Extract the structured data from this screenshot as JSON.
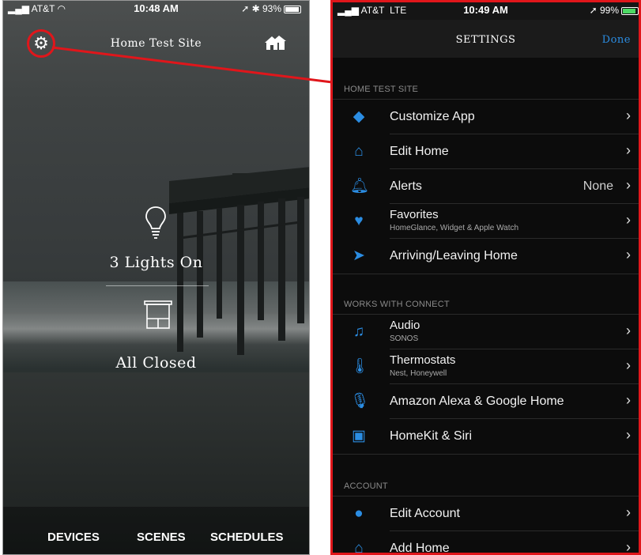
{
  "left": {
    "status": {
      "carrier": "AT&T",
      "time": "10:48 AM",
      "battery": "93%"
    },
    "title": "Home Test Site",
    "lights": "3 Lights On",
    "shades": "All Closed",
    "nav": {
      "devices": "DEVICES",
      "scenes": "SCENES",
      "schedules": "SCHEDULES"
    }
  },
  "right": {
    "status": {
      "carrier": "AT&T",
      "network": "LTE",
      "time": "10:49 AM",
      "battery": "99%"
    },
    "title": "Settings",
    "done": "Done",
    "sections": [
      {
        "header": "HOME TEST SITE"
      },
      {
        "header": "WORKS WITH CONNECT"
      },
      {
        "header": "ACCOUNT"
      }
    ],
    "rows": [
      {
        "label": "Customize App",
        "icon": "cards-icon"
      },
      {
        "label": "Edit Home",
        "icon": "house-icon"
      },
      {
        "label": "Alerts",
        "value": "None",
        "icon": "bell-icon"
      },
      {
        "label": "Favorites",
        "sub": "HomeGlance, Widget & Apple Watch",
        "icon": "heart-icon"
      },
      {
        "label": "Arriving/Leaving Home",
        "icon": "location-arrow-icon"
      },
      {
        "label": "Audio",
        "sub": "SONOS",
        "icon": "music-note-icon"
      },
      {
        "label": "Thermostats",
        "sub": "Nest, Honeywell",
        "icon": "thermometer-icon"
      },
      {
        "label": "Amazon Alexa & Google Home",
        "icon": "microphone-icon"
      },
      {
        "label": "HomeKit & Siri",
        "icon": "homekit-icon"
      },
      {
        "label": "Edit Account",
        "icon": "person-icon"
      },
      {
        "label": "Add Home",
        "icon": "add-home-icon"
      }
    ],
    "accent": "#2b8de3",
    "highlight": "#e0161b"
  }
}
